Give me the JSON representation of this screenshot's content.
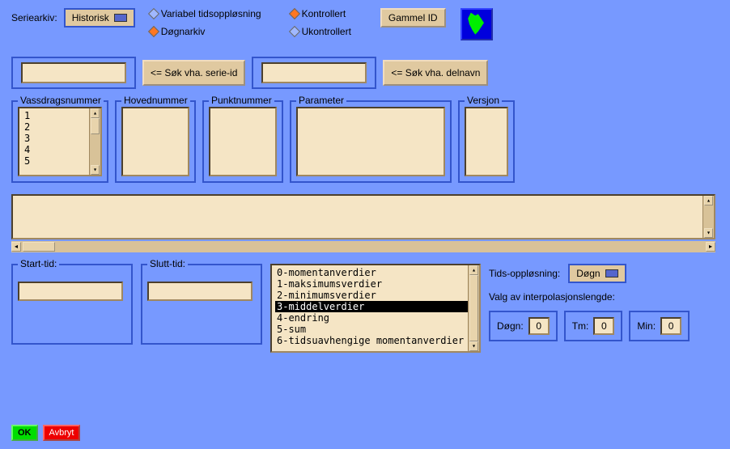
{
  "top": {
    "seriearkiv_label": "Seriearkiv:",
    "seriearkiv_value": "Historisk",
    "radio1": "Variabel tidsoppløsning",
    "radio2": "Døgnarkiv",
    "radio3": "Kontrollert",
    "radio4": "Ukontrollert",
    "gammel_id": "Gammel ID"
  },
  "search": {
    "btn1": "<= Søk vha. serie-id",
    "btn2": "<= Søk vha. delnavn",
    "val1": "",
    "val2": ""
  },
  "panels": {
    "vassdrag": "Vassdragsnummer",
    "hoved": "Hovednummer",
    "punkt": "Punktnummer",
    "param": "Parameter",
    "versjon": "Versjon",
    "vassdrag_items": [
      "1",
      "2",
      "3",
      "4",
      "5"
    ]
  },
  "time": {
    "start_label": "Start-tid:",
    "slutt_label": "Slutt-tid:",
    "start_val": "",
    "slutt_val": ""
  },
  "valuelist": {
    "items": [
      "0-momentanverdier",
      "1-maksimumsverdier",
      "2-minimumsverdier",
      "3-middelverdier",
      "4-endring",
      "5-sum",
      "6-tidsuavhengige momentanverdier"
    ],
    "selected": 3
  },
  "resolution": {
    "label": "Tids-oppløsning:",
    "value": "Døgn",
    "interp_label": "Valg av interpolasjonslengde:",
    "dogn_label": "Døgn:",
    "tm_label": "Tm:",
    "min_label": "Min:",
    "dogn": "0",
    "tm": "0",
    "min": "0"
  },
  "footer": {
    "ok": "OK",
    "cancel": "Avbryt"
  }
}
